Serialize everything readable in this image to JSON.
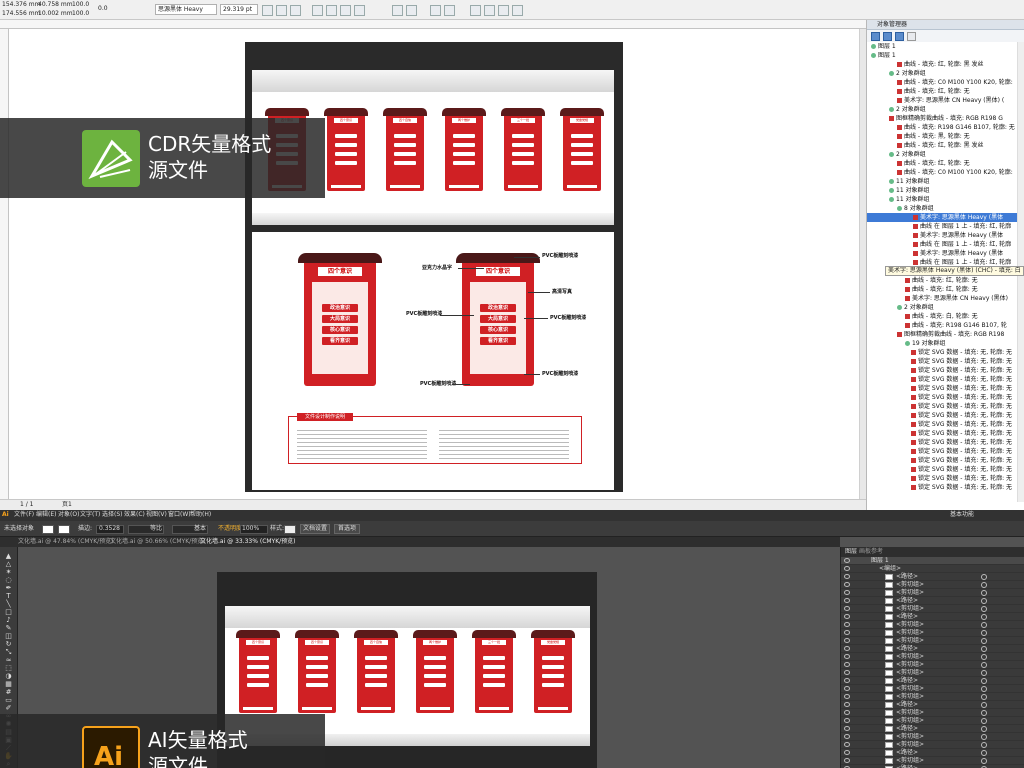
{
  "cdr": {
    "props": {
      "x": "154.376 mm",
      "y": "174.556 mm",
      "w": "40.758 mm",
      "h": "10.002 mm",
      "sx": "100.0",
      "sy": "100.0",
      "rot": "0.0",
      "font": "思源黑体 Heavy",
      "size": "29.319 pt"
    },
    "status": {
      "page": "1 / 1",
      "page_tab": "页1"
    },
    "object_manager": {
      "title": "对象管理器",
      "rows": [
        {
          "text": "图层 1",
          "kind": "grp",
          "ind": 4
        },
        {
          "text": "图层 1",
          "kind": "grp",
          "ind": 4
        },
        {
          "text": "曲线 - 填充: 红, 轮廓: 黑 发丝",
          "kind": "cur",
          "ind": 30
        },
        {
          "text": "2 对象群组",
          "kind": "grp",
          "ind": 22
        },
        {
          "text": "曲线 - 填充: C0 M100 Y100 K20, 轮廓:",
          "kind": "cur",
          "ind": 30
        },
        {
          "text": "曲线 - 填充: 红, 轮廓: 无",
          "kind": "cur",
          "ind": 30
        },
        {
          "text": "美术字: 思源黑体 CN Heavy (黑体) (",
          "kind": "cur",
          "ind": 30
        },
        {
          "text": "2 对象群组",
          "kind": "grp",
          "ind": 22
        },
        {
          "text": "图框精确剪裁曲线 - 填充: RGB R198 G",
          "kind": "cur",
          "ind": 22
        },
        {
          "text": "曲线 - 填充: R198 G146 B107, 轮廓: 无",
          "kind": "cur",
          "ind": 30
        },
        {
          "text": "曲线 - 填充: 黑, 轮廓: 无",
          "kind": "cur",
          "ind": 30
        },
        {
          "text": "曲线 - 填充: 红, 轮廓: 黑 发丝",
          "kind": "cur",
          "ind": 30
        },
        {
          "text": "2 对象群组",
          "kind": "grp",
          "ind": 22
        },
        {
          "text": "曲线 - 填充: 红, 轮廓: 无",
          "kind": "cur",
          "ind": 30
        },
        {
          "text": "曲线 - 填充: C0 M100 Y100 K20, 轮廓:",
          "kind": "cur",
          "ind": 30
        },
        {
          "text": "11 对象群组",
          "kind": "grp",
          "ind": 22
        },
        {
          "text": "11 对象群组",
          "kind": "grp",
          "ind": 22
        },
        {
          "text": "11 对象群组",
          "kind": "grp",
          "ind": 22
        },
        {
          "text": "8 对象群组",
          "kind": "grp",
          "ind": 30
        },
        {
          "text": "美术字: 思源黑体 Heavy (黑体",
          "kind": "cur",
          "ind": 46,
          "sel": true
        },
        {
          "text": "曲线 在 图层 1 上 - 填充: 红, 轮廓",
          "kind": "cur",
          "ind": 46
        },
        {
          "text": "美术字: 思源黑体 Heavy (黑体",
          "kind": "cur",
          "ind": 46
        },
        {
          "text": "曲线 在 图层 1 上 - 填充: 红, 轮廓",
          "kind": "cur",
          "ind": 46
        },
        {
          "text": "美术字: 思源黑体 Heavy (黑体",
          "kind": "cur",
          "ind": 46
        },
        {
          "text": "曲线 在 图层 1 上 - 填充: 红, 轮廓",
          "kind": "cur",
          "ind": 46
        },
        {
          "text": "",
          "kind": "cur",
          "ind": 46
        },
        {
          "text": "曲线 - 填充: 红, 轮廓: 无",
          "kind": "cur",
          "ind": 38
        },
        {
          "text": "曲线 - 填充: 红, 轮廓: 无",
          "kind": "cur",
          "ind": 38
        },
        {
          "text": "美术字: 思源黑体 CN Heavy (黑体)",
          "kind": "cur",
          "ind": 38
        },
        {
          "text": "2 对象群组",
          "kind": "grp",
          "ind": 30
        },
        {
          "text": "曲线 - 填充: 白, 轮廓: 无",
          "kind": "cur",
          "ind": 38
        },
        {
          "text": "曲线 - 填充: R198 G146 B107, 轮",
          "kind": "cur",
          "ind": 38
        },
        {
          "text": "图框精确剪裁曲线 - 填充: RGB R198",
          "kind": "cur",
          "ind": 30
        },
        {
          "text": "19 对象群组",
          "kind": "grp",
          "ind": 38
        },
        {
          "text": "锁定 SVG 数据 - 填充: 无, 轮廓: 无",
          "kind": "cur",
          "ind": 44
        },
        {
          "text": "锁定 SVG 数据 - 填充: 无, 轮廓: 无",
          "kind": "cur",
          "ind": 44
        },
        {
          "text": "锁定 SVG 数据 - 填充: 无, 轮廓: 无",
          "kind": "cur",
          "ind": 44
        },
        {
          "text": "锁定 SVG 数据 - 填充: 无, 轮廓: 无",
          "kind": "cur",
          "ind": 44
        },
        {
          "text": "锁定 SVG 数据 - 填充: 无, 轮廓: 无",
          "kind": "cur",
          "ind": 44
        },
        {
          "text": "锁定 SVG 数据 - 填充: 无, 轮廓: 无",
          "kind": "cur",
          "ind": 44
        },
        {
          "text": "锁定 SVG 数据 - 填充: 无, 轮廓: 无",
          "kind": "cur",
          "ind": 44
        },
        {
          "text": "锁定 SVG 数据 - 填充: 无, 轮廓: 无",
          "kind": "cur",
          "ind": 44
        },
        {
          "text": "锁定 SVG 数据 - 填充: 无, 轮廓: 无",
          "kind": "cur",
          "ind": 44
        },
        {
          "text": "锁定 SVG 数据 - 填充: 无, 轮廓: 无",
          "kind": "cur",
          "ind": 44
        },
        {
          "text": "锁定 SVG 数据 - 填充: 无, 轮廓: 无",
          "kind": "cur",
          "ind": 44
        },
        {
          "text": "锁定 SVG 数据 - 填充: 无, 轮廓: 无",
          "kind": "cur",
          "ind": 44
        },
        {
          "text": "锁定 SVG 数据 - 填充: 无, 轮廓: 无",
          "kind": "cur",
          "ind": 44
        },
        {
          "text": "锁定 SVG 数据 - 填充: 无, 轮廓: 无",
          "kind": "cur",
          "ind": 44
        },
        {
          "text": "锁定 SVG 数据 - 填充: 无, 轮廓: 无",
          "kind": "cur",
          "ind": 44
        },
        {
          "text": "锁定 SVG 数据 - 填充: 无, 轮廓: 无",
          "kind": "cur",
          "ind": 44
        }
      ],
      "tooltip": "美术字: 思源黑体 Heavy (黑体) (CHC) - 填充: 白"
    },
    "page": {
      "sign_title": "四个意识",
      "items": [
        "政治意识",
        "大局意识",
        "核心意识",
        "看齐意识"
      ],
      "callouts": {
        "pvc_top": "PVC板雕刻喷漆",
        "acrylic": "亚克力水晶字",
        "hd_print": "高清写真",
        "pvc_right": "PVC板雕刻喷漆",
        "pvc_left": "PVC板雕刻喷漆",
        "pvc_bottom_left": "PVC板雕刻喷漆",
        "pvc_bottom_right": "PVC板雕刻喷漆"
      },
      "notes_title": "文件设计制作说明",
      "pillar_titles": [
        "四个意识",
        "四个意识",
        "四个自信",
        "两个维护",
        "三个一批",
        "党章党规"
      ]
    },
    "badge": {
      "line1": "CDR矢量格式",
      "line2": "源文件"
    }
  },
  "ai": {
    "menu": [
      "文件(F)",
      "编辑(E)",
      "对象(O)",
      "文字(T)",
      "选择(S)",
      "效果(C)",
      "视图(V)",
      "窗口(W)",
      "帮助(H)"
    ],
    "workspace": "基本功能",
    "ctrl": {
      "selection": "未选择对象",
      "stroke_label": "描边:",
      "stroke_value": "0.3528",
      "uniform": "等比",
      "basic": "基本",
      "opacity_label": "不透明度:",
      "opacity_value": "100%",
      "style_label": "样式:",
      "doc_setup": "文档设置",
      "prefs": "首选项"
    },
    "tabs": [
      "文化墙.ai @ 47.84% (CMYK/预览)",
      "文化墙.ai @ 50.66% (CMYK/预览)",
      "文化墙.ai @ 33.33% (CMYK/预览)"
    ],
    "layers": {
      "tab1": "图层",
      "tab2": "画板参考",
      "top": "图层 1",
      "group": "<编组>",
      "rows": [
        "<路径>",
        "<剪切组>",
        "<剪切组>",
        "<路径>",
        "<剪切组>",
        "<路径>",
        "<剪切组>",
        "<剪切组>",
        "<剪切组>",
        "<路径>",
        "<剪切组>",
        "<剪切组>",
        "<剪切组>",
        "<路径>",
        "<剪切组>",
        "<剪切组>",
        "<路径>",
        "<剪切组>",
        "<剪切组>",
        "<路径>",
        "<剪切组>",
        "<剪切组>",
        "<路径>",
        "<剪切组>",
        "<路径>"
      ]
    },
    "badge": {
      "line1": "AI矢量格式",
      "line2": "源文件"
    }
  },
  "colors": {
    "sign_red": "#d02024",
    "cdr_logo": "#6db33f",
    "ai_logo_bg": "#2b1a00",
    "ai_logo_fg": "#f7a21b"
  }
}
